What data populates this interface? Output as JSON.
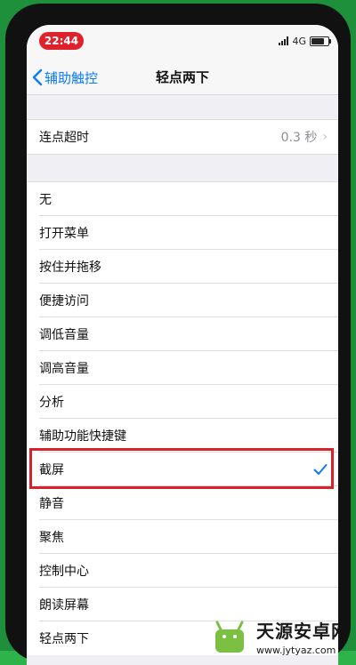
{
  "status_bar": {
    "time": "22:44",
    "network": "4G"
  },
  "nav": {
    "back_label": "辅助触控",
    "title": "轻点两下"
  },
  "timeout_row": {
    "label": "连点超时",
    "value": "0.3 秒"
  },
  "actions": [
    {
      "label": "无",
      "selected": false
    },
    {
      "label": "打开菜单",
      "selected": false
    },
    {
      "label": "按住并拖移",
      "selected": false
    },
    {
      "label": "便捷访问",
      "selected": false
    },
    {
      "label": "调低音量",
      "selected": false
    },
    {
      "label": "调高音量",
      "selected": false
    },
    {
      "label": "分析",
      "selected": false
    },
    {
      "label": "辅助功能快捷键",
      "selected": false
    },
    {
      "label": "截屏",
      "selected": true
    },
    {
      "label": "静音",
      "selected": false
    },
    {
      "label": "聚焦",
      "selected": false
    },
    {
      "label": "控制中心",
      "selected": false
    },
    {
      "label": "朗读屏幕",
      "selected": false
    },
    {
      "label": "轻点两下",
      "selected": false
    }
  ],
  "watermark": {
    "title": "天源安卓网",
    "url": "www.jytyaz.com"
  },
  "colors": {
    "accent": "#0a7aff",
    "highlight": "#d9212b",
    "background": "#2db34a",
    "time_pill": "#e0202a"
  }
}
